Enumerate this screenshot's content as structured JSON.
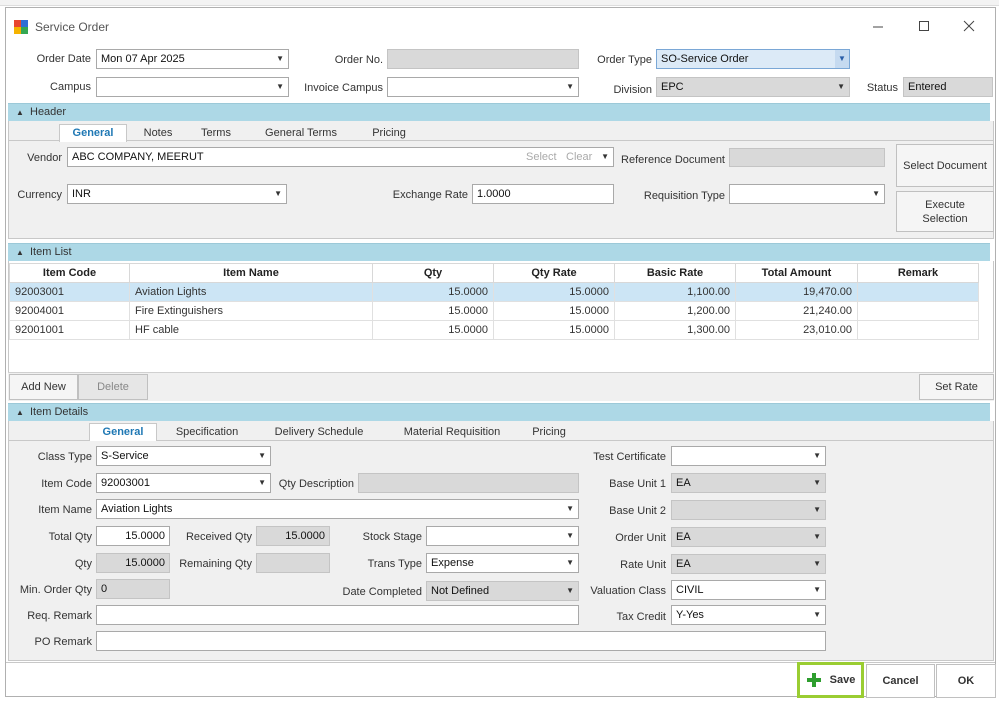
{
  "window": {
    "title": "Service Order"
  },
  "top": {
    "order_date": {
      "label": "Order Date",
      "value": "Mon 07 Apr 2025"
    },
    "order_no": {
      "label": "Order No.",
      "value": ""
    },
    "order_type": {
      "label": "Order Type",
      "value": "SO-Service Order"
    },
    "campus": {
      "label": "Campus",
      "value": ""
    },
    "invoice_campus": {
      "label": "Invoice Campus",
      "value": ""
    },
    "division": {
      "label": "Division",
      "value": "EPC"
    },
    "status": {
      "label": "Status",
      "value": "Entered"
    }
  },
  "header": {
    "title": "Header",
    "tabs": [
      "General",
      "Notes",
      "Terms",
      "General Terms",
      "Pricing"
    ],
    "vendor": {
      "label": "Vendor",
      "value": "ABC COMPANY, MEERUT",
      "select": "Select",
      "clear": "Clear"
    },
    "reference_document": {
      "label": "Reference Document",
      "value": ""
    },
    "select_document_button": "Select Document",
    "currency": {
      "label": "Currency",
      "value": "INR"
    },
    "exchange_rate": {
      "label": "Exchange Rate",
      "value": "1.0000"
    },
    "requisition_type": {
      "label": "Requisition Type",
      "value": ""
    },
    "execute_selection_button": "Execute Selection"
  },
  "item_list": {
    "title": "Item List",
    "columns": [
      "Item Code",
      "Item Name",
      "Qty",
      "Qty Rate",
      "Basic Rate",
      "Total Amount",
      "Remark"
    ],
    "rows": [
      {
        "code": "92003001",
        "name": "Aviation Lights",
        "qty": "15.0000",
        "qty_rate": "15.0000",
        "basic_rate": "1,100.00",
        "total": "19,470.00",
        "remark": ""
      },
      {
        "code": "92004001",
        "name": "Fire Extinguishers",
        "qty": "15.0000",
        "qty_rate": "15.0000",
        "basic_rate": "1,200.00",
        "total": "21,240.00",
        "remark": ""
      },
      {
        "code": "92001001",
        "name": "HF cable",
        "qty": "15.0000",
        "qty_rate": "15.0000",
        "basic_rate": "1,300.00",
        "total": "23,010.00",
        "remark": ""
      }
    ],
    "add_new_button": "Add New",
    "delete_button": "Delete",
    "set_rate_button": "Set Rate"
  },
  "item_details": {
    "title": "Item Details",
    "tabs": [
      "General",
      "Specification",
      "Delivery Schedule",
      "Material Requisition",
      "Pricing"
    ],
    "class_type": {
      "label": "Class Type",
      "value": "S-Service"
    },
    "item_code": {
      "label": "Item Code",
      "value": "92003001"
    },
    "qty_description": {
      "label": "Qty Description",
      "value": ""
    },
    "item_name": {
      "label": "Item Name",
      "value": "Aviation Lights"
    },
    "total_qty": {
      "label": "Total Qty",
      "value": "15.0000"
    },
    "received_qty": {
      "label": "Received Qty",
      "value": "15.0000"
    },
    "stock_stage": {
      "label": "Stock Stage",
      "value": ""
    },
    "qty": {
      "label": "Qty",
      "value": "15.0000"
    },
    "remaining_qty": {
      "label": "Remaining Qty",
      "value": ""
    },
    "trans_type": {
      "label": "Trans Type",
      "value": "Expense"
    },
    "min_order_qty": {
      "label": "Min. Order Qty",
      "value": "0"
    },
    "date_completed": {
      "label": "Date Completed",
      "value": "Not Defined"
    },
    "req_remark": {
      "label": "Req. Remark",
      "value": ""
    },
    "po_remark": {
      "label": "PO Remark",
      "value": ""
    },
    "test_certificate": {
      "label": "Test Certificate",
      "value": ""
    },
    "base_unit_1": {
      "label": "Base Unit 1",
      "value": "EA"
    },
    "base_unit_2": {
      "label": "Base Unit 2",
      "value": ""
    },
    "order_unit": {
      "label": "Order Unit",
      "value": "EA"
    },
    "rate_unit": {
      "label": "Rate Unit",
      "value": "EA"
    },
    "valuation_class": {
      "label": "Valuation Class",
      "value": "CIVIL"
    },
    "tax_credit": {
      "label": "Tax Credit",
      "value": "Y-Yes"
    }
  },
  "footer": {
    "save": "Save",
    "cancel": "Cancel",
    "ok": "OK"
  },
  "colors": {
    "section_bar": "#add8e6",
    "accent": "#1f78b4",
    "save_border": "#9acd32",
    "save_icon": "#2e9e2e"
  }
}
